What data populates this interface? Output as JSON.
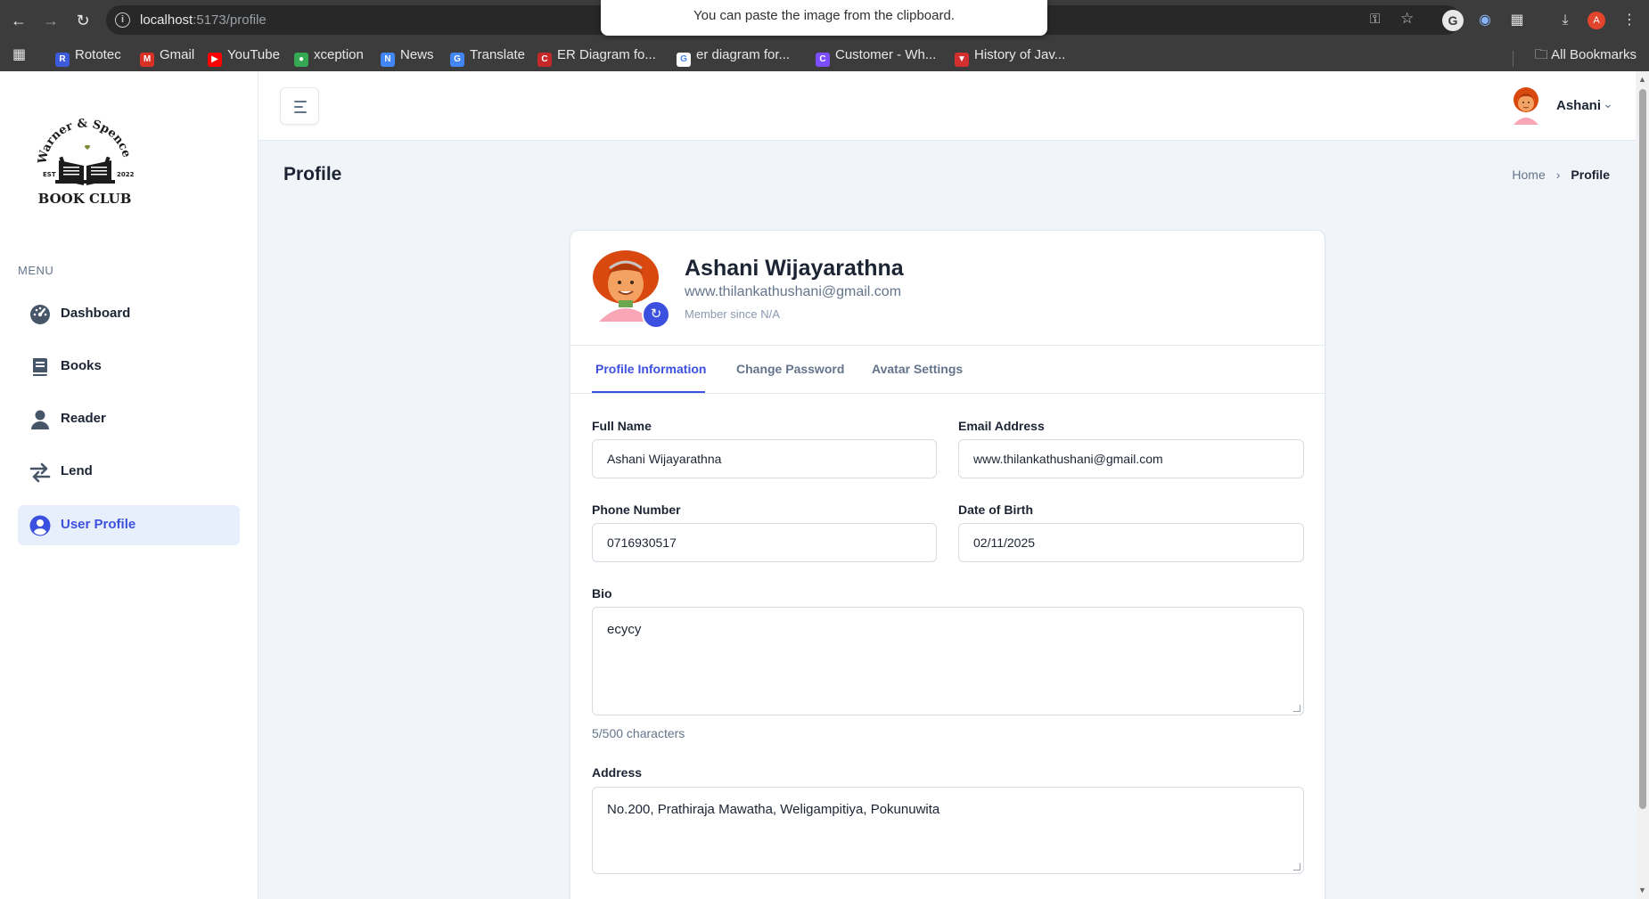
{
  "browser": {
    "url_host": "localhost",
    "url_path": ":5173/profile",
    "paste_toast": "You can paste the image from the clipboard.",
    "profile_initial": "A",
    "bookmarks": [
      {
        "label": "Rototec",
        "icon": "R",
        "color": "#3b5bdb"
      },
      {
        "label": "Gmail",
        "icon": "M",
        "color": "#d93025"
      },
      {
        "label": "YouTube",
        "icon": "▶",
        "color": "#ff0000"
      },
      {
        "label": "xception",
        "icon": "●",
        "color": "#34a853"
      },
      {
        "label": "News",
        "icon": "N",
        "color": "#4285f4"
      },
      {
        "label": "Translate",
        "icon": "G",
        "color": "#4285f4"
      },
      {
        "label": "ER Diagram fo...",
        "icon": "C",
        "color": "#c62828"
      },
      {
        "label": "er diagram for...",
        "icon": "G",
        "color": "#ffffff"
      },
      {
        "label": "Customer - Wh...",
        "icon": "C",
        "color": "#7c4dff"
      },
      {
        "label": "History of Jav...",
        "icon": "▼",
        "color": "#d32f2f"
      }
    ],
    "all_bookmarks": "All Bookmarks"
  },
  "sidebar": {
    "logo_top": "Warner & Spencer",
    "logo_bottom": "BOOK CLUB",
    "logo_est": "EST",
    "logo_year": "2022",
    "menu_label": "MENU",
    "items": [
      {
        "label": "Dashboard",
        "icon": "dashboard-icon"
      },
      {
        "label": "Books",
        "icon": "book-icon"
      },
      {
        "label": "Reader",
        "icon": "user-icon"
      },
      {
        "label": "Lend",
        "icon": "transfer-icon"
      },
      {
        "label": "User Profile",
        "icon": "user-circle-icon",
        "active": true
      }
    ]
  },
  "header": {
    "user_name": "Ashani"
  },
  "page": {
    "title": "Profile",
    "breadcrumb": [
      "Home",
      "Profile"
    ]
  },
  "profile": {
    "name": "Ashani Wijayarathna",
    "email": "www.thilankathushani@gmail.com",
    "member_since": "Member since N/A",
    "tabs": [
      "Profile Information",
      "Change Password",
      "Avatar Settings"
    ],
    "active_tab": 0,
    "form": {
      "full_name_label": "Full Name",
      "full_name": "Ashani Wijayarathna",
      "email_label": "Email Address",
      "email": "www.thilankathushani@gmail.com",
      "phone_label": "Phone Number",
      "phone": "0716930517",
      "dob_label": "Date of Birth",
      "dob": "02/11/2025",
      "bio_label": "Bio",
      "bio": "ecycy",
      "bio_count": "5/500 characters",
      "address_label": "Address",
      "address": "No.200, Prathiraja Mawatha, Weligampitiya, Pokunuwita"
    }
  },
  "colors": {
    "accent": "#3c50e0",
    "avatar_hair": "#d9480f",
    "avatar_skin": "#f4a261"
  }
}
